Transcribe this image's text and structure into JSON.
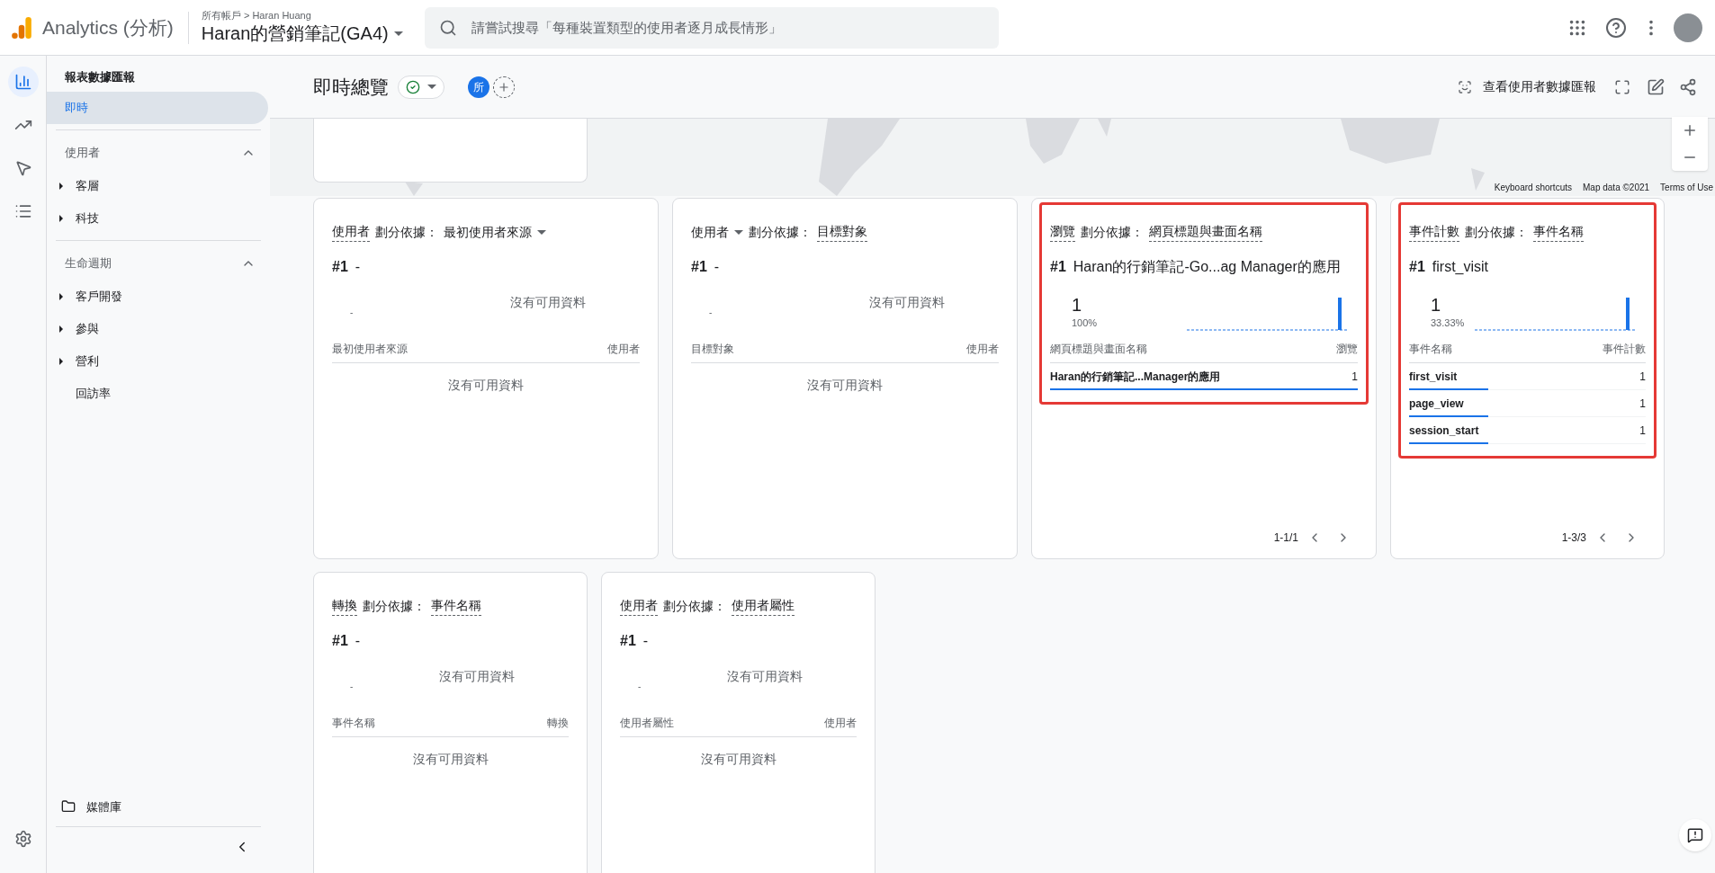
{
  "topbar": {
    "product": "Analytics (分析)",
    "breadcrumb": "所有帳戶 > Haran Huang",
    "property": "Haran的營銷筆記(GA4)",
    "search_placeholder": "請嘗試搜尋「每種裝置類型的使用者逐月成長情形」"
  },
  "rail": [
    {
      "kind": "reports",
      "selected": true
    },
    {
      "kind": "explore",
      "selected": false
    },
    {
      "kind": "advertising",
      "selected": false
    },
    {
      "kind": "configure",
      "selected": false
    }
  ],
  "sidebar": {
    "title": "報表數據匯報",
    "top_items": [
      {
        "label": "即時",
        "selected": true
      }
    ],
    "sections": [
      {
        "title": "使用者",
        "expanded": true,
        "items": [
          {
            "label": "客層",
            "expandable": true
          },
          {
            "label": "科技",
            "expandable": true
          }
        ]
      },
      {
        "title": "生命週期",
        "expanded": true,
        "items": [
          {
            "label": "客戶開發",
            "expandable": true
          },
          {
            "label": "參與",
            "expandable": true
          },
          {
            "label": "營利",
            "expandable": true
          },
          {
            "label": "回訪率",
            "expandable": false
          }
        ]
      }
    ],
    "library": "媒體庫"
  },
  "page": {
    "title": "即時總覽",
    "comparison_chip": "所",
    "report_link": "查看使用者數據匯報"
  },
  "map": {
    "footer": [
      "Keyboard shortcuts",
      "Map data ©2021",
      "Terms of Use"
    ]
  },
  "card_rows": [
    [
      {
        "metric": "使用者",
        "metric_dropdown": false,
        "split_label": "劃分依據：",
        "dimension": "最初使用者來源",
        "dimension_dropdown": true,
        "rank": "#1",
        "top_item": "-",
        "no_data": "沒有可用資料",
        "placeholder_dash": "-",
        "columns": [
          "最初使用者來源",
          "使用者"
        ],
        "empty_text": "沒有可用資料",
        "highlighted": false
      },
      {
        "metric": "使用者",
        "metric_dropdown": true,
        "split_label": "劃分依據：",
        "dimension": "目標對象",
        "dimension_dropdown": false,
        "rank": "#1",
        "top_item": "-",
        "no_data": "沒有可用資料",
        "placeholder_dash": "-",
        "columns": [
          "目標對象",
          "使用者"
        ],
        "empty_text": "沒有可用資料",
        "highlighted": false
      },
      {
        "metric": "瀏覽",
        "metric_dropdown": false,
        "split_label": "劃分依據：",
        "dimension": "網頁標題與畫面名稱",
        "dimension_dropdown": false,
        "rank": "#1",
        "top_item": "Haran的行銷筆記-Go...ag Manager的應用",
        "value": "1",
        "percent": "100%",
        "columns": [
          "網頁標題與畫面名稱",
          "瀏覽"
        ],
        "rows": [
          {
            "label": "Haran的行銷筆記...Manager的應用",
            "value": "1",
            "level": 1
          }
        ],
        "pagination": "1-1/1",
        "highlighted": true
      },
      {
        "metric": "事件計數",
        "metric_dropdown": false,
        "split_label": "劃分依據：",
        "dimension": "事件名稱",
        "dimension_dropdown": false,
        "rank": "#1",
        "top_item": "first_visit",
        "value": "1",
        "percent": "33.33%",
        "columns": [
          "事件名稱",
          "事件計數"
        ],
        "rows": [
          {
            "label": "first_visit",
            "value": "1",
            "level": 0.3333
          },
          {
            "label": "page_view",
            "value": "1",
            "level": 0.3333
          },
          {
            "label": "session_start",
            "value": "1",
            "level": 0.3333
          }
        ],
        "pagination": "1-3/3",
        "highlighted": true
      }
    ],
    [
      {
        "metric": "轉換",
        "metric_dropdown": false,
        "split_label": "劃分依據：",
        "dimension": "事件名稱",
        "dimension_dropdown": false,
        "rank": "#1",
        "top_item": "-",
        "no_data": "沒有可用資料",
        "placeholder_dash": "-",
        "columns": [
          "事件名稱",
          "轉換"
        ],
        "empty_text": "沒有可用資料",
        "highlighted": false
      },
      {
        "metric": "使用者",
        "metric_dropdown": false,
        "split_label": "劃分依據：",
        "dimension": "使用者屬性",
        "dimension_dropdown": false,
        "rank": "#1",
        "top_item": "-",
        "no_data": "沒有可用資料",
        "placeholder_dash": "-",
        "columns": [
          "使用者屬性",
          "使用者"
        ],
        "empty_text": "沒有可用資料",
        "highlighted": false
      }
    ]
  ]
}
